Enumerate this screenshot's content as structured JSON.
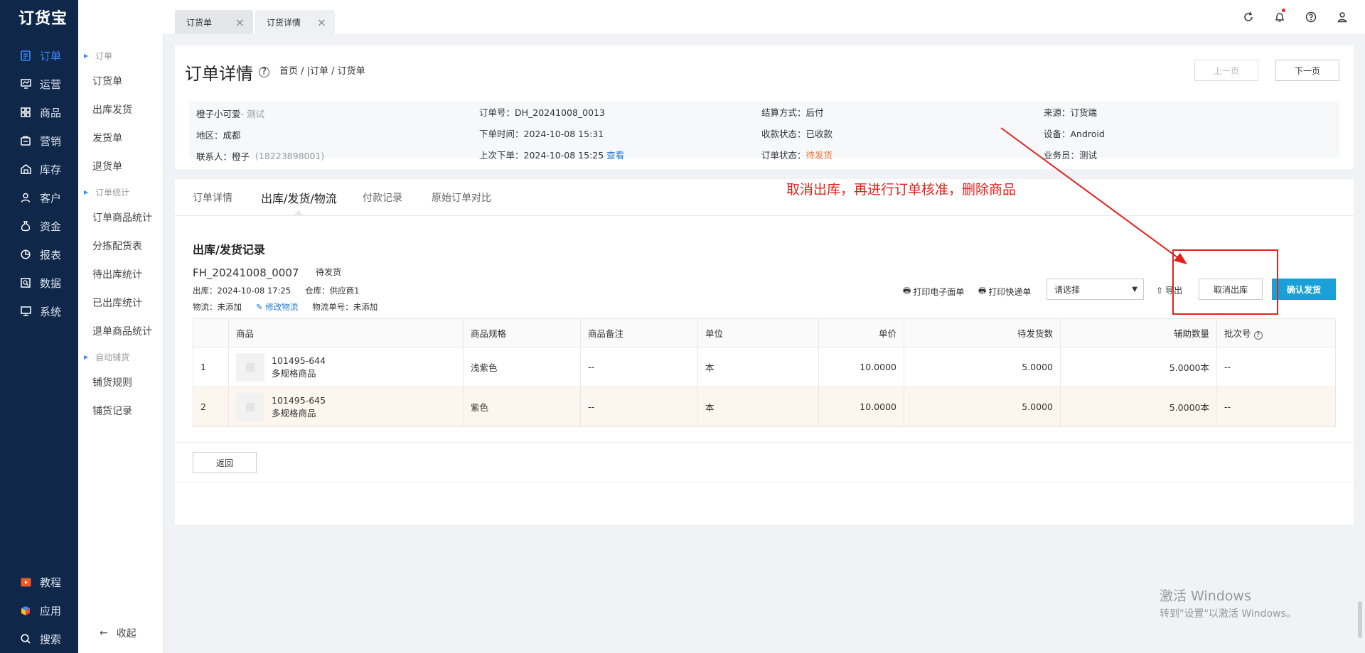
{
  "app": {
    "logo": "订货宝"
  },
  "nav": {
    "items": [
      {
        "label": "订单",
        "icon": "order-icon",
        "active": true
      },
      {
        "label": "运营",
        "icon": "operation-icon"
      },
      {
        "label": "商品",
        "icon": "grid-icon"
      },
      {
        "label": "营销",
        "icon": "marketing-icon"
      },
      {
        "label": "库存",
        "icon": "warehouse-icon"
      },
      {
        "label": "客户",
        "icon": "user-icon"
      },
      {
        "label": "资金",
        "icon": "money-bag-icon"
      },
      {
        "label": "报表",
        "icon": "pie-chart-icon"
      },
      {
        "label": "数据",
        "icon": "data-icon"
      },
      {
        "label": "系统",
        "icon": "monitor-icon"
      }
    ],
    "bottom": [
      {
        "label": "教程",
        "icon": "video-icon"
      },
      {
        "label": "应用",
        "icon": "cube-icon"
      },
      {
        "label": "搜索",
        "icon": "search-icon"
      }
    ]
  },
  "subnav": {
    "group1": "订单",
    "group1_items": [
      "订货单",
      "出库发货",
      "发货单",
      "退货单"
    ],
    "group2": "订单统计",
    "group2_items": [
      "订单商品统计",
      "分拣配货表",
      "待出库统计",
      "已出库统计",
      "退单商品统计"
    ],
    "group3": "自动铺货",
    "group3_items": [
      "铺货规则",
      "铺货记录"
    ],
    "collapse": "收起"
  },
  "tabs": [
    {
      "label": "订货单"
    },
    {
      "label": "订货详情"
    }
  ],
  "header": {
    "title": "订单详情",
    "breadcrumb": "首页 / |订单 / 订货单",
    "prev": "上一页",
    "next": "下一页"
  },
  "info": {
    "customer": "橙子小可爱",
    "customer_tag": " - 测试",
    "region": "地区：成都",
    "contact_label": "联系人：",
    "contact_name": "橙子",
    "contact_phone": "(18223898001)",
    "order_no": "订单号：DH_20241008_0013",
    "order_time": "下单时间：2024-10-08 15:31",
    "last_order": "上次下单：2024-10-08 15:25",
    "last_order_link": "查看",
    "settle": "结算方式：后付",
    "pay_status": "收款状态：已收款",
    "order_status_label": "订单状态：",
    "order_status": "待发货",
    "source": "来源：订货端",
    "device": "设备：Android",
    "salesman": "业务员：测试"
  },
  "subtabs": [
    "订单详情",
    "出库/发货/物流",
    "付款记录",
    "原始订单对比"
  ],
  "annotation": "取消出库，再进行订单核准，删除商品",
  "shipment": {
    "section_title": "出库/发货记录",
    "no": "FH_20241008_0007",
    "status": "待发货",
    "out_time": "出库：2024-10-08 17:25",
    "warehouse": "仓库：供应商1",
    "logistics": "物流：未添加",
    "edit_logistics": "修改物流",
    "tracking": "物流单号：未添加",
    "print_e": "打印电子面单",
    "print_express": "打印快递单",
    "select_placeholder": "请选择",
    "export": "导出",
    "cancel_out": "取消出库",
    "confirm_ship": "确认发货"
  },
  "table": {
    "headers": [
      "",
      "商品",
      "商品规格",
      "商品备注",
      "单位",
      "单价",
      "待发货数",
      "辅助数量",
      "批次号"
    ],
    "rows": [
      {
        "idx": "1",
        "code": "101495-644",
        "name": "多规格商品",
        "spec": "浅紫色",
        "remark": "--",
        "unit": "本",
        "price": "10.0000",
        "qty": "5.0000",
        "aux": "5.0000本",
        "batch": "--"
      },
      {
        "idx": "2",
        "code": "101495-645",
        "name": "多规格商品",
        "spec": "紫色",
        "remark": "--",
        "unit": "本",
        "price": "10.0000",
        "qty": "5.0000",
        "aux": "5.0000本",
        "batch": "--"
      }
    ]
  },
  "back": "返回",
  "watermark": {
    "line1": "激活 Windows",
    "line2": "转到\"设置\"以激活 Windows。"
  },
  "colors": {
    "sidebar": "#0f2749",
    "accent": "#3d8bff",
    "confirm": "#1aa0d8",
    "annotation": "#e3211b",
    "status": "#f5712c"
  }
}
